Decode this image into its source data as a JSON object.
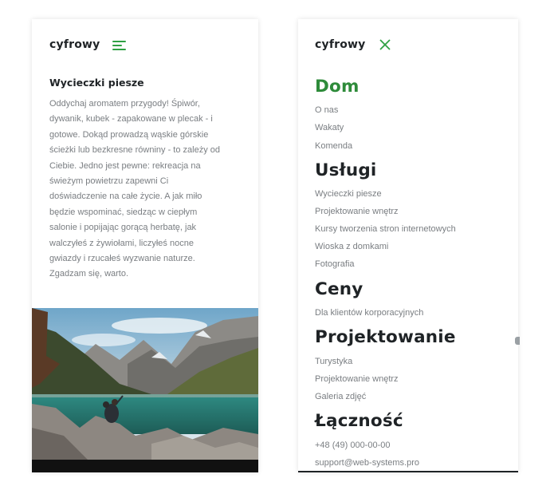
{
  "brand": "cyfrowy",
  "article": {
    "title": "Wycieczki piesze",
    "lines": [
      "Oddychaj aromatem przygody! Śpiwór,",
      "dywanik, kubek - zapakowane w plecak - i",
      "gotowe. Dokąd prowadzą wąskie górskie",
      "ścieżki lub bezkresne równiny - to zależy od",
      "Ciebie. Jedno jest pewne: rekreacja na",
      "świeżym powietrzu zapewni Ci",
      "doświadczenie na całe życie. A jak miło",
      "będzie wspominać, siedząc w ciepłym",
      "salonie i popijając gorącą herbatę, jak",
      "walczyłeś z żywiołami, liczyłeś nocne",
      "gwiazdy i rzucałeś wyzwanie naturze.",
      "Zgadzam się, warto."
    ]
  },
  "menu": {
    "sections": [
      {
        "heading": "Dom",
        "active": true,
        "links": [
          "O nas",
          "Wakaty",
          "Komenda"
        ]
      },
      {
        "heading": "Usługi",
        "active": false,
        "links": [
          "Wycieczki piesze",
          "Projektowanie wnętrz",
          "Kursy tworzenia stron internetowych",
          "Wioska z domkami",
          "Fotografia"
        ]
      },
      {
        "heading": "Ceny",
        "active": false,
        "links": [
          "Dla klientów korporacyjnych"
        ]
      },
      {
        "heading": "Projektowanie",
        "active": false,
        "links": [
          "Turystyka",
          "Projektowanie wnętrz",
          "Galeria zdjęć"
        ]
      },
      {
        "heading": "Łączność",
        "active": false,
        "links": [
          "+48 (49) 000-00-00",
          "support@web-systems.pro"
        ]
      }
    ]
  },
  "icons": {
    "menu_toggle": "hamburger-icon",
    "close": "close-icon"
  },
  "colors": {
    "accent": "#2ea043",
    "active_heading": "#2e8b3a",
    "heading": "#1f2326",
    "muted_text": "#7a7e82"
  }
}
